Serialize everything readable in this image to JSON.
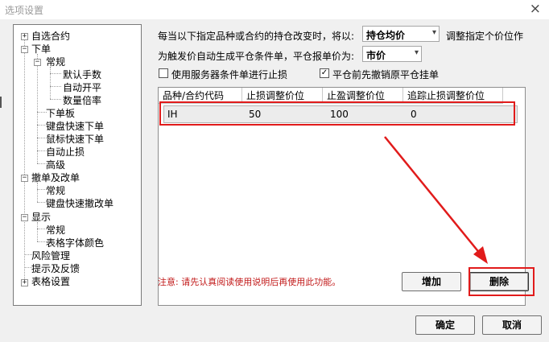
{
  "window": {
    "title": "选项设置",
    "close_label": "×"
  },
  "tree": {
    "items": [
      {
        "label": "自选合约"
      },
      {
        "label": "下单"
      },
      {
        "label": "常规"
      },
      {
        "label": "默认手数"
      },
      {
        "label": "自动开平"
      },
      {
        "label": "数量倍率"
      },
      {
        "label": "下单板"
      },
      {
        "label": "键盘快速下单"
      },
      {
        "label": "鼠标快速下单"
      },
      {
        "label": "自动止损"
      },
      {
        "label": "高级"
      },
      {
        "label": "撤单及改单"
      },
      {
        "label": "常规"
      },
      {
        "label": "键盘快速撤改单"
      },
      {
        "label": "显示"
      },
      {
        "label": "常规"
      },
      {
        "label": "表格字体颜色"
      },
      {
        "label": "风险管理"
      },
      {
        "label": "提示及反馈"
      },
      {
        "label": "表格设置"
      }
    ],
    "expand_plus": "+",
    "expand_minus": "−"
  },
  "settings": {
    "line1_prefix": "每当以下指定品种或合约的持仓改变时，将以:",
    "price_basis": "持仓均价",
    "line1_suffix": "调整指定个价位作",
    "line2_prefix": "为触发价自动生成平仓条件单，平仓报单价为:",
    "order_price": "市价",
    "dropdown_arrow": "▾",
    "use_server_label": "使用服务器条件单进行止损",
    "use_server_checked": false,
    "cancel_first_label": "平仓前先撤销原平仓挂单",
    "cancel_first_checked": true,
    "check_mark": "✓"
  },
  "table": {
    "columns": [
      "品种/合约代码",
      "止损调整价位",
      "止盈调整价位",
      "追踪止损调整价位"
    ],
    "rows": [
      [
        "IH",
        "50",
        "100",
        "0"
      ]
    ]
  },
  "note": "注意: 请先认真阅读使用说明后再使用此功能。",
  "buttons": {
    "add": "增加",
    "delete": "删除",
    "ok": "确定",
    "cancel": "取消"
  },
  "colors": {
    "annotation_red": "#e11b1b",
    "note_red": "#c21a1a"
  }
}
